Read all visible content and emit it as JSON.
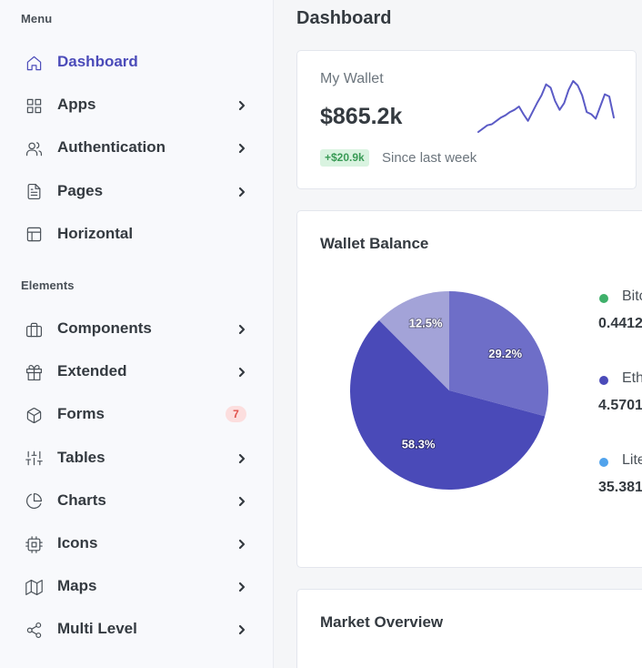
{
  "sidebar": {
    "sections": [
      {
        "title": "Menu",
        "items": [
          {
            "label": "Dashboard",
            "icon": "home-icon",
            "active": true,
            "chevron": false
          },
          {
            "label": "Apps",
            "icon": "grid-icon",
            "chevron": true
          },
          {
            "label": "Authentication",
            "icon": "users-icon",
            "chevron": true
          },
          {
            "label": "Pages",
            "icon": "file-text-icon",
            "chevron": true
          },
          {
            "label": "Horizontal",
            "icon": "layout-icon",
            "chevron": false
          }
        ]
      },
      {
        "title": "Elements",
        "items": [
          {
            "label": "Components",
            "icon": "briefcase-icon",
            "chevron": true
          },
          {
            "label": "Extended",
            "icon": "gift-icon",
            "chevron": true
          },
          {
            "label": "Forms",
            "icon": "box-icon",
            "badge": "7",
            "chevron": false
          },
          {
            "label": "Tables",
            "icon": "sliders-icon",
            "chevron": true
          },
          {
            "label": "Charts",
            "icon": "pie-chart-icon",
            "chevron": true
          },
          {
            "label": "Icons",
            "icon": "cpu-icon",
            "chevron": true
          },
          {
            "label": "Maps",
            "icon": "map-icon",
            "chevron": true
          },
          {
            "label": "Multi Level",
            "icon": "share-icon",
            "chevron": true
          }
        ]
      }
    ]
  },
  "main": {
    "page_title": "Dashboard",
    "wallet": {
      "label": "My Wallet",
      "value": "$865.2k",
      "delta": "+$20.9k",
      "since": "Since last week",
      "sparkline_color": "#5b5bc6"
    },
    "balance": {
      "title": "Wallet Balance",
      "legend": [
        {
          "name": "Bitc",
          "value": "0.4412",
          "color": "#3fb06a"
        },
        {
          "name": "Eth",
          "value": "4.5701",
          "color": "#4b4bb9"
        },
        {
          "name": "Lite",
          "value": "35.381",
          "color": "#51a3ec"
        }
      ]
    },
    "market": {
      "title": "Market Overview"
    }
  },
  "chart_data": [
    {
      "type": "pie",
      "categories": [
        "Ethereum",
        "Bitcoin",
        "Litecoin"
      ],
      "values": [
        58.3,
        29.2,
        12.5
      ],
      "labels": [
        "58.3%",
        "29.2%",
        "12.5%"
      ],
      "colors": [
        "#4a4ab8",
        "#6e6ec8",
        "#a3a3d8"
      ]
    },
    {
      "type": "line",
      "values": [
        2,
        5,
        8,
        9,
        12,
        15,
        17,
        20,
        22,
        25,
        18,
        12,
        20,
        28,
        35,
        45,
        42,
        30,
        22,
        28,
        40,
        48,
        44,
        35,
        20,
        18,
        14,
        25,
        36,
        34,
        15
      ]
    }
  ]
}
